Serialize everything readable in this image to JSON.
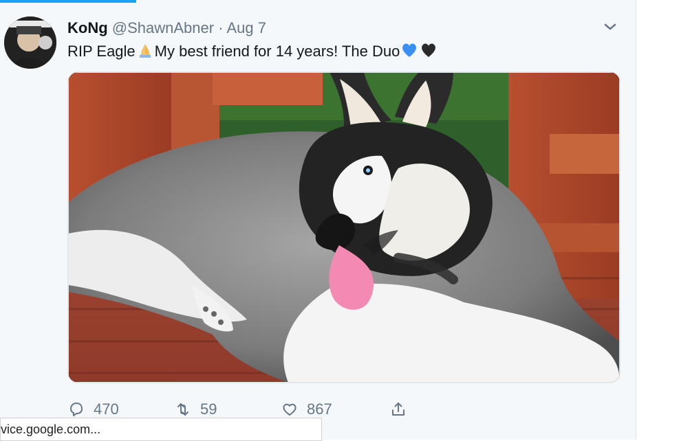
{
  "tweet": {
    "display_name": "KoNg",
    "handle": "@ShawnAbner",
    "separator": "·",
    "date": "Aug 7",
    "text_before": "RIP Eagle",
    "text_middle": "My best friend for 14 years! The Duo",
    "media_description": "Husky dog lying on wooden playhouse deck"
  },
  "actions": {
    "replies": "470",
    "retweets": "59",
    "likes": "867"
  },
  "statusbar": {
    "url": "vice.google.com..."
  },
  "colors": {
    "accent": "#1da1f2",
    "secondary_text": "#657786",
    "primary_text": "#14171a"
  },
  "icons": [
    "chevron-down-icon",
    "folded-hands-emoji",
    "blue-heart-emoji",
    "black-heart-emoji",
    "reply-icon",
    "retweet-icon",
    "like-icon",
    "share-icon"
  ]
}
